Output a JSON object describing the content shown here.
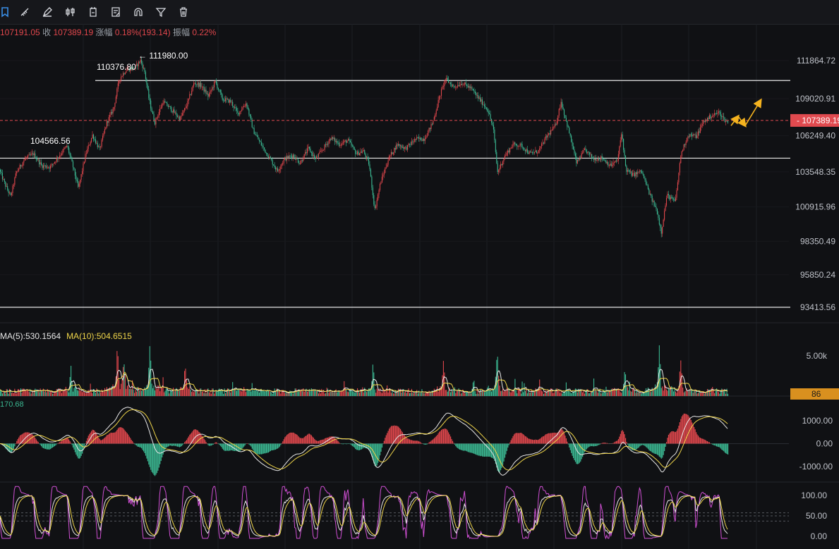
{
  "toolbar": {
    "tools": [
      {
        "name": "bookmark-icon"
      },
      {
        "name": "ruler-icon"
      },
      {
        "name": "pen-icon"
      },
      {
        "name": "candles-icon"
      },
      {
        "name": "date-icon"
      },
      {
        "name": "note-icon"
      },
      {
        "name": "magnet-icon"
      },
      {
        "name": "filter-icon"
      },
      {
        "name": "trash-icon"
      }
    ]
  },
  "ohlc": {
    "open_value": "107191.05",
    "close_label": "收",
    "close_value": "107389.19",
    "change_label": "涨幅",
    "change_value": "0.18%(193.14)",
    "amplitude_label": "振幅",
    "amplitude_value": "0.22%"
  },
  "volume_legend": {
    "ma5": "MA(5):530.1564",
    "ma10": "MA(10):504.6515"
  },
  "macd_legend": {
    "value": "170.68"
  },
  "colors": {
    "up": "#e0474c",
    "down": "#3bb892",
    "price_tag": "#e04a4f",
    "volume_tag": "#d9901f",
    "ma10": "#f0d64a",
    "kdj_j": "#d04fd4",
    "arrow": "#f5b31f"
  },
  "chart_data": {
    "type": "candlestick",
    "price_axis": {
      "ticks": [
        "111864.72",
        "109020.91",
        "106249.40",
        "103548.35",
        "100915.96",
        "98350.49",
        "95850.24",
        "93413.56"
      ],
      "tick_values": [
        111864.72,
        109020.91,
        106249.4,
        103548.35,
        100915.96,
        98350.49,
        95850.24,
        93413.56
      ],
      "range": [
        92400,
        114000
      ]
    },
    "current_price": "107389.19",
    "current_price_value": 107389.19,
    "annotations": [
      {
        "text": "111980.00",
        "value": 111980.0,
        "prefix": "←"
      },
      {
        "text": "110376.80",
        "value": 110376.8
      },
      {
        "text": "104566.56",
        "value": 104566.56
      }
    ],
    "horizontal_levels": [
      110376.8,
      104566.56,
      93413.56
    ],
    "price_path": [
      [
        0,
        103700
      ],
      [
        8,
        102600
      ],
      [
        16,
        101700
      ],
      [
        24,
        103500
      ],
      [
        36,
        104500
      ],
      [
        48,
        104900
      ],
      [
        60,
        104000
      ],
      [
        72,
        103900
      ],
      [
        84,
        104700
      ],
      [
        96,
        105500
      ],
      [
        104,
        104000
      ],
      [
        112,
        102300
      ],
      [
        122,
        104800
      ],
      [
        132,
        106300
      ],
      [
        142,
        105200
      ],
      [
        152,
        107200
      ],
      [
        162,
        108300
      ],
      [
        170,
        110500
      ],
      [
        180,
        111200
      ],
      [
        192,
        111300
      ],
      [
        200,
        111900
      ],
      [
        206,
        111000
      ],
      [
        212,
        109000
      ],
      [
        220,
        107200
      ],
      [
        232,
        108800
      ],
      [
        244,
        108200
      ],
      [
        256,
        107500
      ],
      [
        266,
        108600
      ],
      [
        276,
        110200
      ],
      [
        286,
        110000
      ],
      [
        296,
        109200
      ],
      [
        306,
        110300
      ],
      [
        316,
        109000
      ],
      [
        328,
        108800
      ],
      [
        338,
        107900
      ],
      [
        350,
        108700
      ],
      [
        360,
        106600
      ],
      [
        372,
        105500
      ],
      [
        384,
        104500
      ],
      [
        394,
        103600
      ],
      [
        404,
        104500
      ],
      [
        416,
        104800
      ],
      [
        426,
        104200
      ],
      [
        438,
        105300
      ],
      [
        448,
        104500
      ],
      [
        458,
        105200
      ],
      [
        470,
        106100
      ],
      [
        482,
        105600
      ],
      [
        494,
        105900
      ],
      [
        506,
        104900
      ],
      [
        516,
        105100
      ],
      [
        524,
        104100
      ],
      [
        532,
        100700
      ],
      [
        540,
        102700
      ],
      [
        552,
        104600
      ],
      [
        564,
        105600
      ],
      [
        576,
        105300
      ],
      [
        590,
        106000
      ],
      [
        602,
        106000
      ],
      [
        614,
        107200
      ],
      [
        624,
        109200
      ],
      [
        632,
        110500
      ],
      [
        644,
        109900
      ],
      [
        656,
        110200
      ],
      [
        668,
        109800
      ],
      [
        680,
        109000
      ],
      [
        692,
        108200
      ],
      [
        700,
        106800
      ],
      [
        706,
        103500
      ],
      [
        716,
        104700
      ],
      [
        728,
        105600
      ],
      [
        740,
        105500
      ],
      [
        752,
        104900
      ],
      [
        764,
        105100
      ],
      [
        776,
        106200
      ],
      [
        788,
        107000
      ],
      [
        796,
        108800
      ],
      [
        806,
        106800
      ],
      [
        818,
        104200
      ],
      [
        830,
        105200
      ],
      [
        842,
        104500
      ],
      [
        854,
        104600
      ],
      [
        866,
        104000
      ],
      [
        876,
        104400
      ],
      [
        882,
        106500
      ],
      [
        888,
        103700
      ],
      [
        898,
        103300
      ],
      [
        910,
        103600
      ],
      [
        922,
        101800
      ],
      [
        932,
        100600
      ],
      [
        938,
        99000
      ],
      [
        946,
        101800
      ],
      [
        958,
        101300
      ],
      [
        966,
        104900
      ],
      [
        976,
        106300
      ],
      [
        988,
        106200
      ],
      [
        998,
        107300
      ],
      [
        1008,
        107700
      ],
      [
        1020,
        108000
      ],
      [
        1030,
        107300
      ]
    ],
    "projection_arrows": [
      [
        [
          1036,
          107000
        ],
        [
          1046,
          107700
        ]
      ],
      [
        [
          1046,
          107700
        ],
        [
          1056,
          107000
        ]
      ],
      [
        [
          1056,
          107000
        ],
        [
          1078,
          108900
        ]
      ]
    ],
    "volume": {
      "axis_ticks": [
        "5.00k"
      ],
      "tag_value": "86",
      "spikes": [
        [
          100,
          0.85
        ],
        [
          166,
          1.5
        ],
        [
          175,
          1.0
        ],
        [
          212,
          1.8
        ],
        [
          262,
          0.95
        ],
        [
          528,
          1.0
        ],
        [
          628,
          1.05
        ],
        [
          704,
          1.6
        ],
        [
          885,
          0.9
        ],
        [
          934,
          1.8
        ],
        [
          964,
          1.25
        ]
      ]
    },
    "macd": {
      "axis_ticks": [
        "1000.00",
        "0.00",
        "-1000.00"
      ],
      "tick_values": [
        1000,
        0,
        -1000
      ],
      "range": [
        -1350,
        1350
      ]
    },
    "kdj": {
      "axis_ticks": [
        "100.00",
        "50.00",
        "0.00"
      ],
      "tick_values": [
        100,
        50,
        0
      ],
      "dashed_levels": [
        80,
        50,
        20
      ],
      "range": [
        -5,
        122
      ]
    }
  }
}
